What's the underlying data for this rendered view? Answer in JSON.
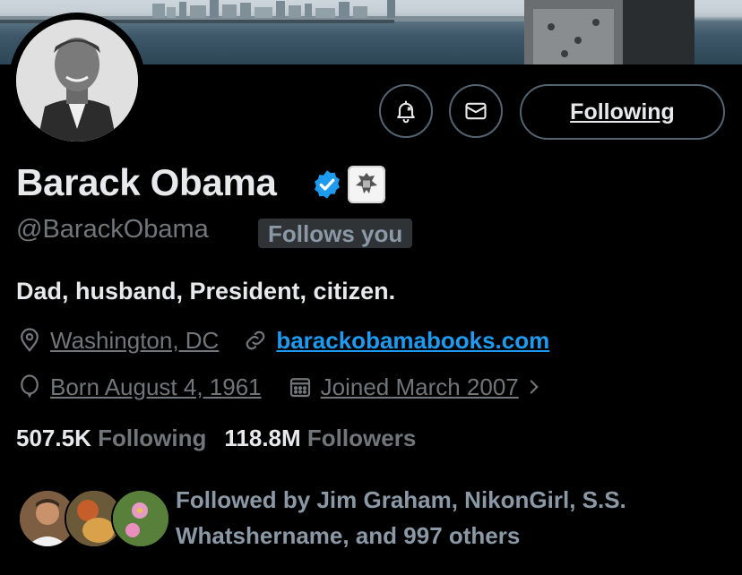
{
  "header": {
    "following_button": "Following"
  },
  "profile": {
    "name": "Barack Obama",
    "handle": "@BarackObama",
    "follows_you_badge": "Follows you",
    "bio": "Dad, husband, President, citizen.",
    "location": "Washington, DC",
    "website": "barackobamabooks.com",
    "birthday": "Born August 4, 1961",
    "joined": "Joined March 2007"
  },
  "stats": {
    "following_count": "507.5K",
    "following_label": "Following",
    "followers_count": "118.8M",
    "followers_label": "Followers"
  },
  "followed_by": "Followed by Jim Graham, NikonGirl, S.S. Whatshername, and 997 others",
  "colors": {
    "background": "#000000",
    "text": "#e7e9ea",
    "muted": "#71767b",
    "link": "#1d9bf0",
    "verified": "#1d9bf0"
  },
  "icons": [
    "notification-bell-icon",
    "mail-icon",
    "location-pin-icon",
    "link-icon",
    "birthday-balloon-icon",
    "calendar-icon",
    "chevron-right-icon",
    "verified-badge-icon",
    "government-seal-icon"
  ]
}
